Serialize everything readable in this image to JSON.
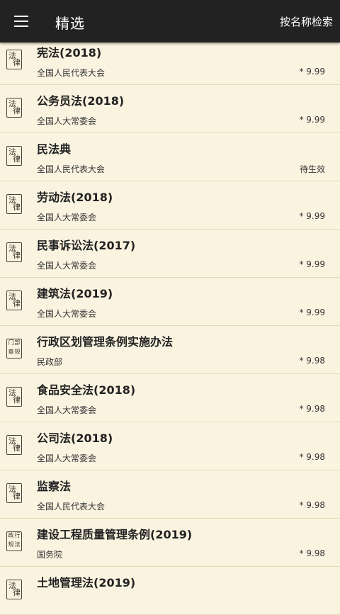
{
  "header": {
    "title": "精选",
    "search_label": "按名称检索",
    "menu_icon": "menu-icon"
  },
  "colors": {
    "topbar": "#222222",
    "background": "#faf3e0",
    "divider": "#e6d9b8"
  },
  "items": [
    {
      "title": "宪法(2018)",
      "issuer": "全国人民代表大会",
      "score": "* 9.99",
      "badge": [
        "法",
        "律"
      ]
    },
    {
      "title": "公务员法(2018)",
      "issuer": "全国人大常委会",
      "score": "* 9.99",
      "badge": [
        "法",
        "律"
      ]
    },
    {
      "title": "民法典",
      "issuer": "全国人民代表大会",
      "score": "待生效",
      "badge": [
        "法",
        "律"
      ]
    },
    {
      "title": "劳动法(2018)",
      "issuer": "全国人大常委会",
      "score": "* 9.99",
      "badge": [
        "法",
        "律"
      ]
    },
    {
      "title": "民事诉讼法(2017)",
      "issuer": "全国人大常委会",
      "score": "* 9.99",
      "badge": [
        "法",
        "律"
      ]
    },
    {
      "title": "建筑法(2019)",
      "issuer": "全国人大常委会",
      "score": "* 9.99",
      "badge": [
        "法",
        "律"
      ]
    },
    {
      "title": "行政区划管理条例实施办法",
      "issuer": "民政部",
      "score": "* 9.98",
      "badge": [
        "部门",
        "规章"
      ]
    },
    {
      "title": "食品安全法(2018)",
      "issuer": "全国人大常委会",
      "score": "* 9.98",
      "badge": [
        "法",
        "律"
      ]
    },
    {
      "title": "公司法(2018)",
      "issuer": "全国人大常委会",
      "score": "* 9.98",
      "badge": [
        "法",
        "律"
      ]
    },
    {
      "title": "监察法",
      "issuer": "全国人民代表大会",
      "score": "* 9.98",
      "badge": [
        "法",
        "律"
      ]
    },
    {
      "title": "建设工程质量管理条例(2019)",
      "issuer": "国务院",
      "score": "* 9.98",
      "badge": [
        "行政",
        "法规"
      ]
    },
    {
      "title": "土地管理法(2019)",
      "issuer": "",
      "score": "",
      "badge": [
        "法",
        "律"
      ]
    }
  ]
}
